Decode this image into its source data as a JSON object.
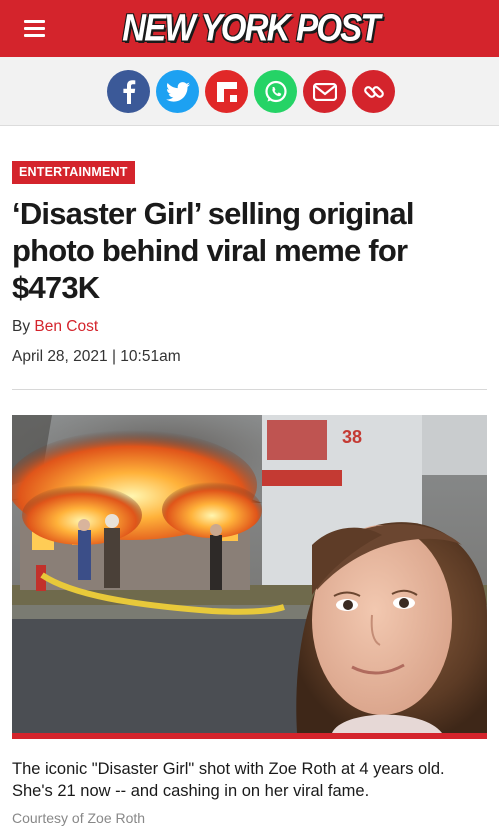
{
  "header": {
    "logo_text": "NEW YORK POST",
    "menu_icon": "hamburger-menu-icon",
    "brand_color": "#d4242c"
  },
  "share_bar": {
    "buttons": [
      {
        "network": "facebook",
        "icon": "facebook-icon",
        "color": "#3b5998"
      },
      {
        "network": "twitter",
        "icon": "twitter-icon",
        "color": "#1da1f2"
      },
      {
        "network": "flipboard",
        "icon": "flipboard-icon",
        "color": "#e12828"
      },
      {
        "network": "whatsapp",
        "icon": "whatsapp-icon",
        "color": "#25d366"
      },
      {
        "network": "email",
        "icon": "email-icon",
        "color": "#d4242c"
      },
      {
        "network": "copy-link",
        "icon": "link-icon",
        "color": "#d4242c"
      }
    ]
  },
  "article": {
    "section": "ENTERTAINMENT",
    "headline": "‘Disaster Girl’ selling original photo behind viral meme for $473K",
    "byline_prefix": "By ",
    "author": "Ben Cost",
    "date": "April 28, 2021 | 10:51am"
  },
  "photo": {
    "caption": "The iconic \"Disaster Girl\" shot with Zoe Roth at 4 years old. She's 21 now -- and cashing in on her viral fame.",
    "credit": "Courtesy of Zoe Roth",
    "truck_number": "38"
  }
}
